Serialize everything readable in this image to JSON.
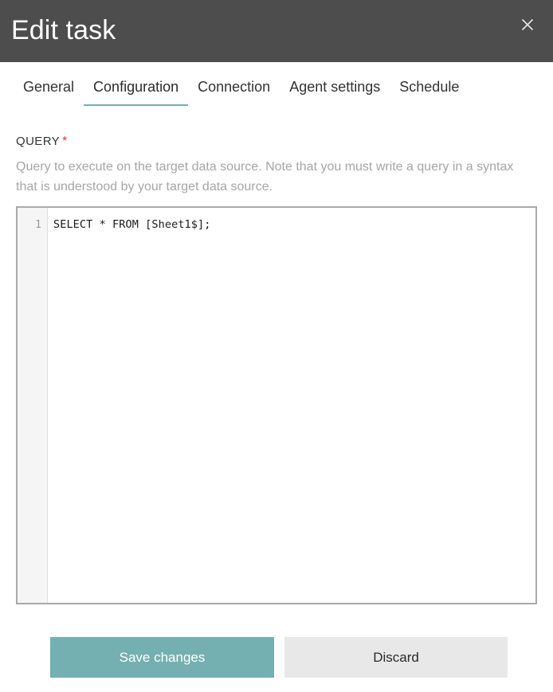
{
  "dialog": {
    "title": "Edit task",
    "close_icon": "close-icon",
    "header_bg": "#4d4d4d"
  },
  "tabs": {
    "items": [
      {
        "label": "General",
        "active": false
      },
      {
        "label": "Configuration",
        "active": true
      },
      {
        "label": "Connection",
        "active": false
      },
      {
        "label": "Agent settings",
        "active": false
      },
      {
        "label": "Schedule",
        "active": false
      }
    ],
    "accent_color": "#74afb1"
  },
  "query_field": {
    "label": "QUERY",
    "required_mark": "*",
    "required_color": "#e03a2f",
    "help_text": "Query to execute on the target data source. Note that you must write a query in a syntax that is understood by your target data source."
  },
  "editor": {
    "line_numbers": [
      "1"
    ],
    "lines": [
      "SELECT * FROM [Sheet1$];"
    ],
    "value": "SELECT * FROM [Sheet1$];"
  },
  "footer": {
    "save_label": "Save changes",
    "discard_label": "Discard",
    "save_color": "#74afb1",
    "discard_color": "#e8e8e8"
  }
}
